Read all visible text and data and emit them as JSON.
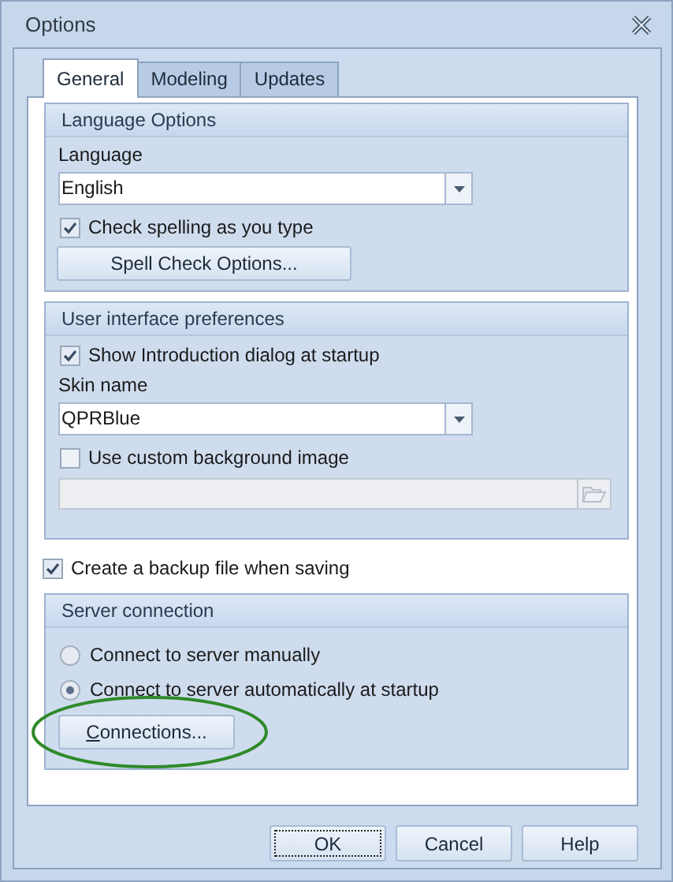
{
  "window": {
    "title": "Options"
  },
  "tabs": [
    {
      "label": "General",
      "selected": true
    },
    {
      "label": "Modeling",
      "selected": false
    },
    {
      "label": "Updates",
      "selected": false
    }
  ],
  "language_options": {
    "title": "Language Options",
    "language_label": "Language",
    "language": {
      "value": "English"
    },
    "spell_check": {
      "label": "Check spelling as you type",
      "checked": true
    },
    "spell_button": "Spell Check Options..."
  },
  "ui_preferences": {
    "title": "User interface preferences",
    "show_intro": {
      "label": "Show Introduction dialog at startup",
      "checked": true
    },
    "skin_label": "Skin name",
    "skin": {
      "value": "QPRBlue"
    },
    "custom_background": {
      "label": "Use custom background image",
      "checked": false
    },
    "background_path": {
      "disabled": true
    }
  },
  "backup": {
    "label": "Create a backup file when saving",
    "checked": true
  },
  "server_connection": {
    "title": "Server connection",
    "options": [
      {
        "label": "Connect to server manually",
        "selected": false
      },
      {
        "label": "Connect to server automatically at startup",
        "selected": true
      }
    ],
    "connections_button": {
      "label": "Connections...",
      "mnemonic_first": true,
      "highlighted": true
    }
  },
  "buttons": [
    {
      "label": "OK",
      "focused": true
    },
    {
      "label": "Cancel",
      "focused": false
    },
    {
      "label": "Help",
      "focused": false
    }
  ]
}
